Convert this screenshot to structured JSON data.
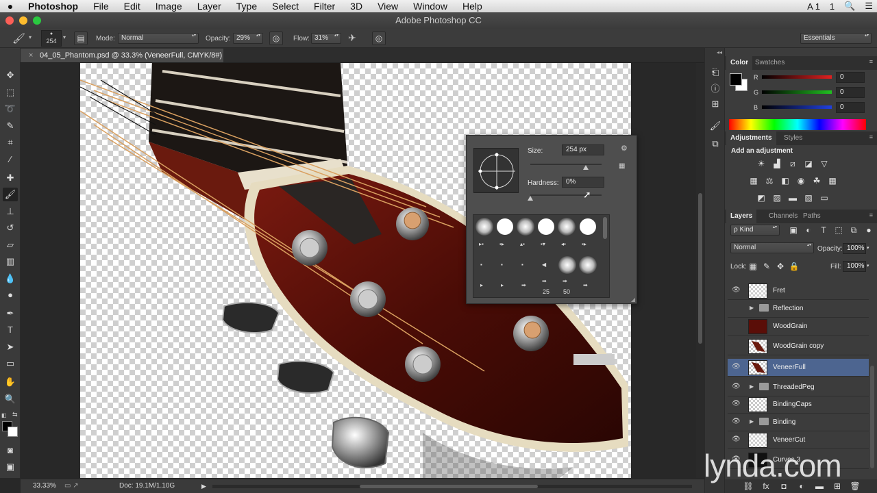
{
  "menubar": {
    "apple": "",
    "app": "Photoshop",
    "items": [
      "File",
      "Edit",
      "Image",
      "Layer",
      "Type",
      "Select",
      "Filter",
      "3D",
      "View",
      "Window",
      "Help"
    ],
    "right": [
      "A 1",
      "1",
      "🔍",
      "☰"
    ]
  },
  "window_title": "Adobe Photoshop CC",
  "options": {
    "brush_size": "254",
    "mode_label": "Mode:",
    "mode_value": "Normal",
    "opacity_label": "Opacity:",
    "opacity_value": "29%",
    "flow_label": "Flow:",
    "flow_value": "31%",
    "workspace": "Essentials"
  },
  "document": {
    "tab_title": "04_05_Phantom.psd @ 33.3% (VeneerFull, CMYK/8#) *",
    "close": "×"
  },
  "status": {
    "zoom": "33.33%",
    "doc": "Doc: 19.1M/1.10G"
  },
  "brush_popup": {
    "size_label": "Size:",
    "size_value": "254 px",
    "hardness_label": "Hardness:",
    "hardness_value": "0%",
    "size_level": 0.78,
    "hardness_level": 0.0,
    "preset_labels": [
      "25",
      "50"
    ]
  },
  "color_panel": {
    "tabs": [
      "Color",
      "Swatches"
    ],
    "channels": [
      {
        "name": "R",
        "value": "0",
        "color": "#e02020"
      },
      {
        "name": "G",
        "value": "0",
        "color": "#20c020"
      },
      {
        "name": "B",
        "value": "0",
        "color": "#2040e0"
      }
    ]
  },
  "adjustments_panel": {
    "tabs": [
      "Adjustments",
      "Styles"
    ],
    "heading": "Add an adjustment"
  },
  "layers_panel": {
    "tabs": [
      "Layers",
      "Channels",
      "Paths"
    ],
    "filter": "ρ Kind",
    "blend_mode": "Normal",
    "opacity_label": "Opacity:",
    "opacity_value": "100%",
    "lock_label": "Lock:",
    "fill_label": "Fill:",
    "fill_value": "100%",
    "layers": [
      {
        "name": "Fret",
        "visible": true,
        "type": "layer",
        "thumb": "checker"
      },
      {
        "name": "Reflection",
        "visible": false,
        "type": "group"
      },
      {
        "name": "WoodGrain",
        "visible": false,
        "type": "layer",
        "thumb": "wood"
      },
      {
        "name": "WoodGrain copy",
        "visible": false,
        "type": "layer",
        "thumb": "shape"
      },
      {
        "name": "VeneerFull",
        "visible": true,
        "type": "layer",
        "thumb": "shape",
        "selected": true
      },
      {
        "name": "ThreadedPeg",
        "visible": true,
        "type": "group"
      },
      {
        "name": "BindingCaps",
        "visible": true,
        "type": "layer",
        "thumb": "checker"
      },
      {
        "name": "Binding",
        "visible": true,
        "type": "group"
      },
      {
        "name": "VeneerCut",
        "visible": true,
        "type": "layer",
        "thumb": "checker"
      },
      {
        "name": "Curves 3",
        "visible": true,
        "type": "layer",
        "thumb": "dark"
      }
    ]
  },
  "watermark": "lynda.com"
}
